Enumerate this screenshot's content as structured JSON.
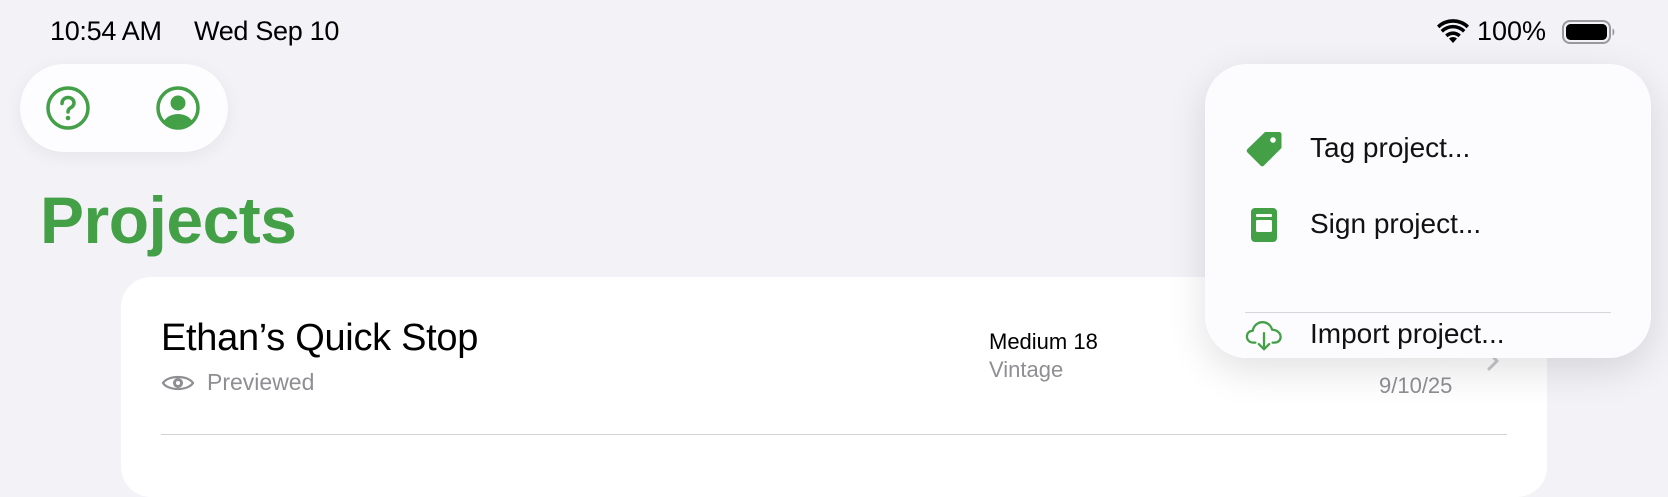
{
  "status_bar": {
    "time": "10:54 AM",
    "date": "Wed Sep 10",
    "battery": "100%"
  },
  "toolbar": {
    "help_icon": "question-circle-icon",
    "account_icon": "person-circle-icon"
  },
  "page": {
    "title": "Projects"
  },
  "projects": [
    {
      "title": "Ethan’s Quick Stop",
      "status": "Previewed",
      "size": "Medium 18",
      "style": "Vintage",
      "date": "9/10/25"
    }
  ],
  "menu": {
    "items": [
      {
        "label": "Tag project...",
        "icon": "tag-icon"
      },
      {
        "label": "Sign project...",
        "icon": "document-icon"
      },
      {
        "label": "Import project...",
        "icon": "cloud-download-icon"
      }
    ]
  },
  "colors": {
    "accent": "#43a047",
    "background": "#f2f2f7"
  }
}
